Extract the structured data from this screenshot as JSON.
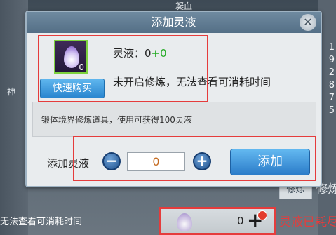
{
  "background": {
    "side_char": "神",
    "top_label": "凝血",
    "stats": [
      "1",
      "9",
      "2",
      "8",
      "7",
      "5"
    ],
    "tabs": [
      "修炼",
      "修炼"
    ],
    "bottom_left": "无法查看可消耗时间",
    "slot_count": "0",
    "status": "灵液已耗尽"
  },
  "dialog": {
    "title": "添加灵液",
    "close": "✕",
    "item": {
      "quantity": "0",
      "name_label": "灵液：0",
      "name_plus": "+0",
      "info": "未开启修炼，无法查看可消耗时间"
    },
    "buy_button": "快速购买",
    "description": "锻体境界修炼道具，使用可获得100灵液",
    "add_label": "添加灵液",
    "minus": "−",
    "plus": "+",
    "amount": "0",
    "confirm_button": "添加"
  },
  "colors": {
    "highlight": "#e53c3c",
    "accent_blue": "#2a86cf",
    "item_border_green": "#7dd23e"
  }
}
